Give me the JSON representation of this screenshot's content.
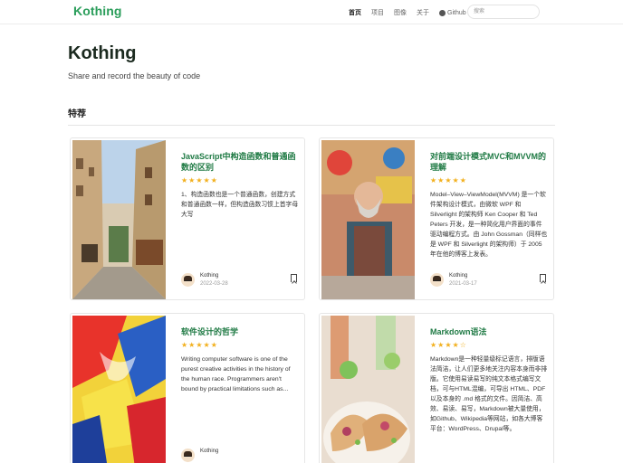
{
  "header": {
    "brand": "Kothing",
    "nav": [
      {
        "label": "首页",
        "active": true
      },
      {
        "label": "项目",
        "active": false
      },
      {
        "label": "图像",
        "active": false
      },
      {
        "label": "关于",
        "active": false
      },
      {
        "label": "Github",
        "active": false
      }
    ],
    "search_placeholder": "搜索"
  },
  "hero": {
    "title": "Kothing",
    "subtitle": "Share and record the beauty of code"
  },
  "section": {
    "title": "特荐"
  },
  "cards": [
    {
      "title": "JavaScript中构造函数和普通函数的区别",
      "rating": "★★★★★",
      "excerpt": "1、构造函数也是一个普通函数，创建方式和普通函数一样，但构造函数习惯上首字母大写",
      "author": "Kothing",
      "date": "2022-03-28",
      "image": "city-street-photo"
    },
    {
      "title": "对前端设计模式MVC和MVVM的理解",
      "rating": "★★★★★",
      "excerpt": "Model–View–ViewModel(MVVM) 是一个软件架构设计模式，由微软 WPF 和 Silverlight 的架构师 Ken Cooper 和 Ted Peters 开发，是一种简化用户界面的事件驱动编程方式。由 John Gossman（同样也是 WPF 和 Silverlight 的架构师）于 2005年在他的博客上发表。",
      "author": "Kothing",
      "date": "2021-03-17",
      "image": "painter-photo"
    },
    {
      "title": "软件设计的哲学",
      "rating": "★★★★★",
      "excerpt": "Writing computer software is one of the purest creative activities in the history of the human race. Programmers aren't bound by practical limitations such as...",
      "author": "Kothing",
      "date": "",
      "image": "abstract-painting"
    },
    {
      "title": "Markdown语法",
      "rating": "★★★★☆",
      "excerpt": "Markdown是一种轻量级标记语言，排版语法简洁，让人们更多地关注内容本身而非排版。它使用易读易写的纯文本格式编写文档，可与HTML混编，可导出 HTML、PDF 以及本身的 .md 格式的文件。因简洁、高效、易读、易写，Markdown被大量使用，如Github、Wikipedia等网站，如各大博客平台：WordPress、Drupal等。",
      "author": "Kothing",
      "date": "",
      "image": "tacos-photo"
    }
  ],
  "colors": {
    "brand": "#2a9d5a",
    "title": "#1f7a44",
    "star": "#f2b01e"
  }
}
